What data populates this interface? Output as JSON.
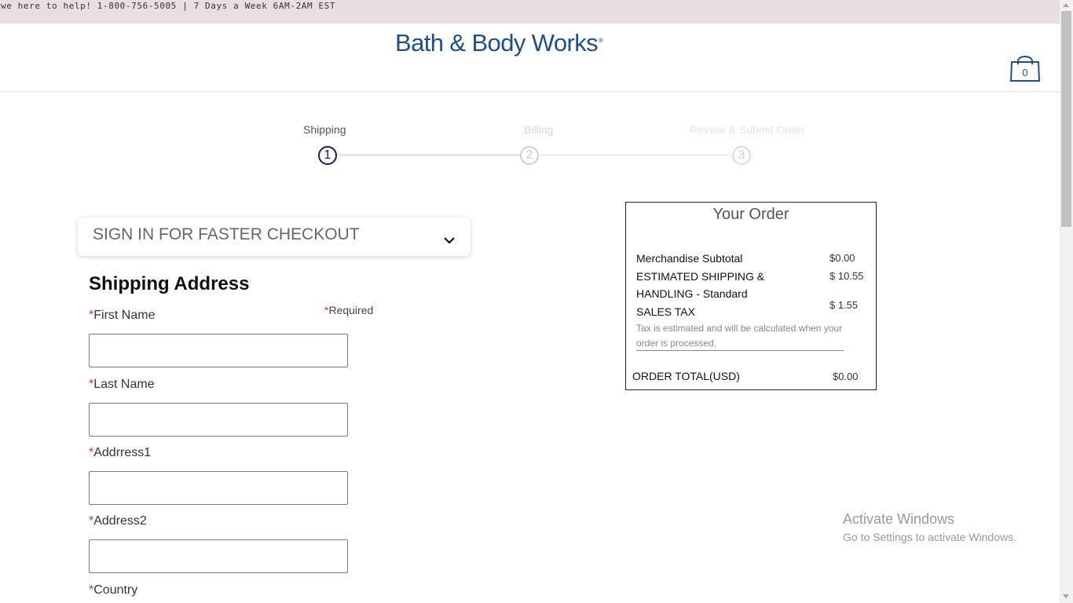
{
  "topbar": {
    "text": "we here to help! 1-800-756-5005 | 7 Days a Week 6AM-2AM EST"
  },
  "header": {
    "logo_text": "Bath & Body Works",
    "logo_mark": "®",
    "cart_count": "0",
    "cart_icon": "shopping-bag-icon",
    "brand_color": "#1d4f8f"
  },
  "steps": [
    {
      "label": "Shipping",
      "number": "1",
      "state": "active"
    },
    {
      "label": "Billing",
      "number": "2",
      "state": "inactive"
    },
    {
      "label": "Reveiw & Submit Order",
      "number": "3",
      "state": "inactive"
    }
  ],
  "signin": {
    "label": "SIGN IN FOR FASTER CHECKOUT",
    "icon": "chevron-down-icon"
  },
  "shipping": {
    "title": "Shipping Address",
    "required_star": "*",
    "required_note": "Required",
    "fields": [
      {
        "label": "First Name",
        "value": ""
      },
      {
        "label": "Last Name",
        "value": ""
      },
      {
        "label": "Addrress1",
        "value": ""
      },
      {
        "label": "Address2",
        "value": ""
      },
      {
        "label": "Country",
        "value": ""
      }
    ]
  },
  "order": {
    "title": "Your Order",
    "merch_label": "Merchandise Subtotal",
    "merch_value": "$0.00",
    "shipping_label_1": "ESTIMATED SHIPPING &",
    "shipping_label_2": "HANDLING - Standard",
    "shipping_value": "$ 10.55",
    "tax_label": "SALES TAX",
    "tax_value": "$ 1.55",
    "tax_note": "Tax is estimated and will be calculated when your order is processed.",
    "total_label": "ORDER TOTAL(USD)",
    "total_value": "$0.00"
  },
  "watermark": {
    "title": "Activate Windows",
    "subtitle": "Go to Settings to activate Windows."
  }
}
